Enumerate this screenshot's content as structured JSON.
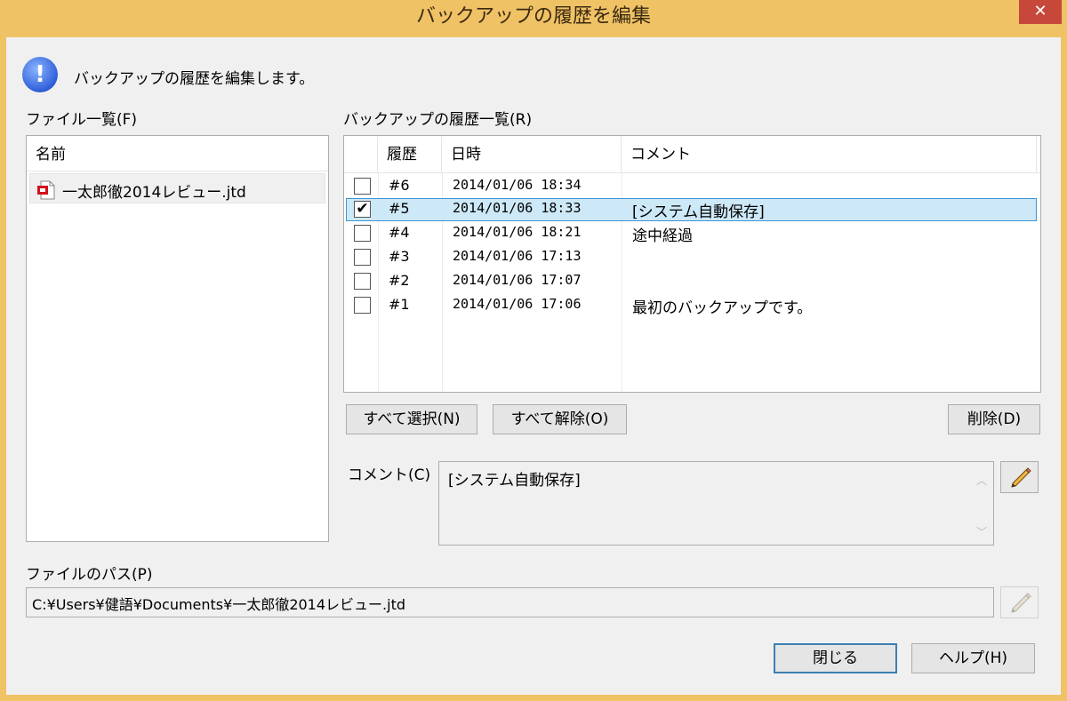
{
  "window": {
    "title": "バックアップの履歴を編集",
    "close_glyph": "✕"
  },
  "info": {
    "icon": "info-icon",
    "message": "バックアップの履歴を編集します。"
  },
  "file_list": {
    "label": "ファイル一覧(F)",
    "column": "名前",
    "items": [
      {
        "name": "一太郎徹2014レビュー.jtd",
        "icon": "ichitaro-file-icon"
      }
    ]
  },
  "history_list": {
    "label": "バックアップの履歴一覧(R)",
    "columns": {
      "history": "履歴",
      "datetime": "日時",
      "comment": "コメント"
    },
    "rows": [
      {
        "checked": false,
        "no": "#6",
        "datetime": "2014/01/06 18:34",
        "comment": "",
        "selected": false
      },
      {
        "checked": true,
        "no": "#5",
        "datetime": "2014/01/06 18:33",
        "comment": "[システム自動保存]",
        "selected": true
      },
      {
        "checked": false,
        "no": "#4",
        "datetime": "2014/01/06 18:21",
        "comment": "途中経過",
        "selected": false
      },
      {
        "checked": false,
        "no": "#3",
        "datetime": "2014/01/06 17:13",
        "comment": "",
        "selected": false
      },
      {
        "checked": false,
        "no": "#2",
        "datetime": "2014/01/06 17:07",
        "comment": "",
        "selected": false
      },
      {
        "checked": false,
        "no": "#1",
        "datetime": "2014/01/06 17:06",
        "comment": "最初のバックアップです。",
        "selected": false
      }
    ],
    "check_glyph": "✔"
  },
  "buttons": {
    "select_all": "すべて選択(N)",
    "deselect_all": "すべて解除(O)",
    "delete": "削除(D)",
    "close": "閉じる",
    "help": "ヘルプ(H)"
  },
  "comment": {
    "label": "コメント(C)",
    "value": "[システム自動保存]",
    "edit_icon": "pencil-icon"
  },
  "path": {
    "label": "ファイルのパス(P)",
    "value": "C:¥Users¥健語¥Documents¥一太郎徹2014レビュー.jtd",
    "edit_icon": "pencil-icon"
  },
  "colors": {
    "title_bar": "#f0c266",
    "close_button": "#c7473a",
    "selection": "#cde8f7",
    "selection_border": "#3c94d2"
  }
}
